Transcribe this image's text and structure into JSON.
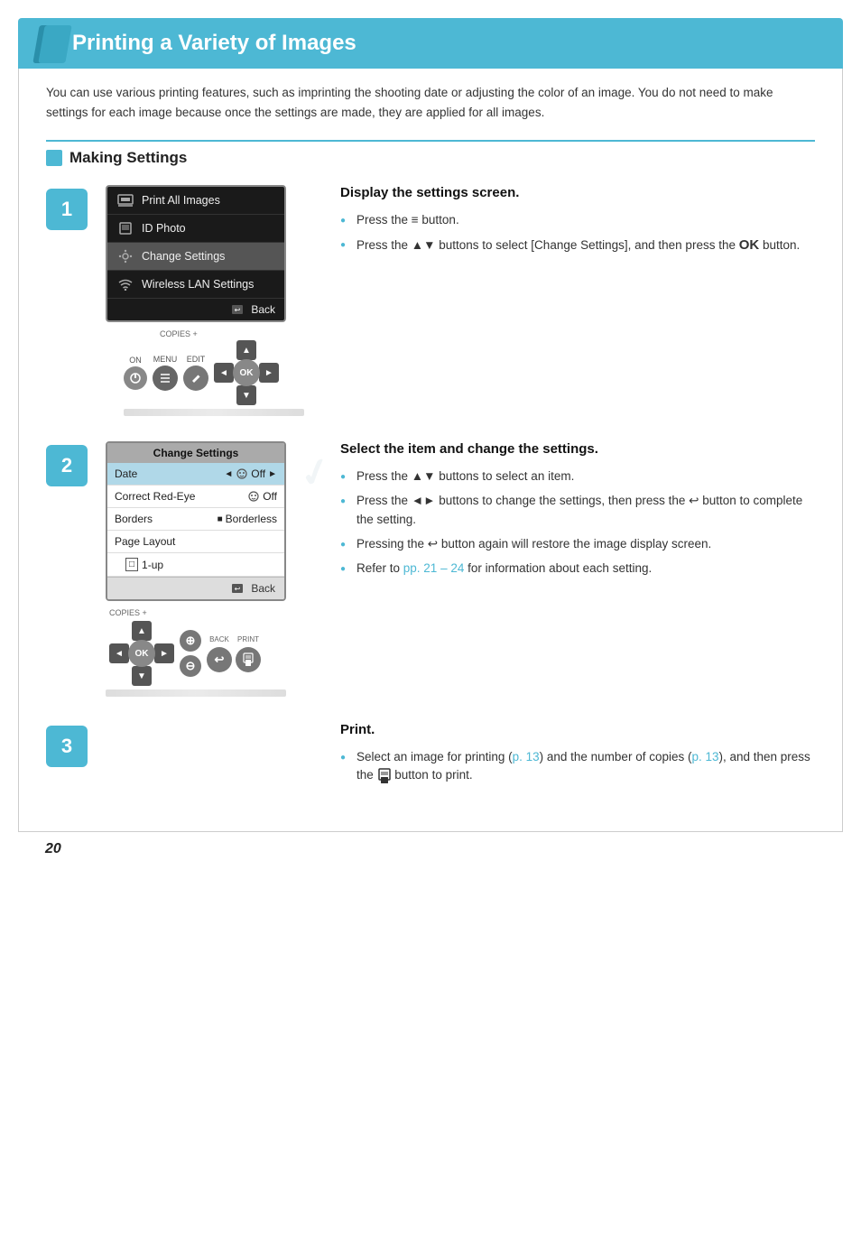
{
  "page": {
    "title": "Printing a Variety of Images",
    "number": "20"
  },
  "intro": {
    "text": "You can use various printing features, such as imprinting the shooting date or adjusting the color of an image. You do not need to make settings for each image because once the settings are made, they are applied for all images."
  },
  "section": {
    "title": "Making Settings"
  },
  "steps": [
    {
      "number": "1",
      "title": "Display the settings screen.",
      "bullets": [
        "Press the ≡ button.",
        "Press the ▲▼ buttons to select [Change Settings], and then press the OK button."
      ],
      "menu_items": [
        {
          "icon": "image",
          "label": "Print All Images",
          "selected": false
        },
        {
          "icon": "id",
          "label": "ID Photo",
          "selected": false
        },
        {
          "icon": "gear",
          "label": "Change Settings",
          "selected": true
        },
        {
          "icon": "wifi",
          "label": "Wireless LAN Settings",
          "selected": false
        }
      ],
      "back_label": "Back"
    },
    {
      "number": "2",
      "title": "Select the item and change the settings.",
      "bullets": [
        "Press the ▲▼ buttons to select an item.",
        "Press the ◄► buttons to change the settings, then press the ↩ button to complete the setting.",
        "Pressing the ↩ button again will restore the image display screen.",
        "Refer to pp. 21 – 24 for information about each setting."
      ],
      "settings_title": "Change Settings",
      "settings_rows": [
        {
          "label": "Date",
          "value": "Off",
          "icon": "Q",
          "selected": true
        },
        {
          "label": "Correct Red-Eye",
          "value": "Off",
          "icon": "Q"
        },
        {
          "label": "Borders",
          "value": "Borderless",
          "icon": "■"
        },
        {
          "label": "Page Layout",
          "value": ""
        },
        {
          "label": "1-up",
          "value": "",
          "indent": true
        }
      ],
      "back_label": "Back"
    },
    {
      "number": "3",
      "title": "Print.",
      "bullets": [
        "Select an image for printing (p. 13) and the number of copies (p. 13), and then press the print button to print."
      ]
    }
  ],
  "labels": {
    "copies_plus": "COPIES +",
    "on": "ON",
    "menu": "MENU",
    "edit": "EDIT",
    "ok": "OK",
    "back_btn": "BACK",
    "print_btn": "PRINT",
    "back_arrow": "↩",
    "up": "▲",
    "down": "▼",
    "left": "◄",
    "right": "►"
  }
}
